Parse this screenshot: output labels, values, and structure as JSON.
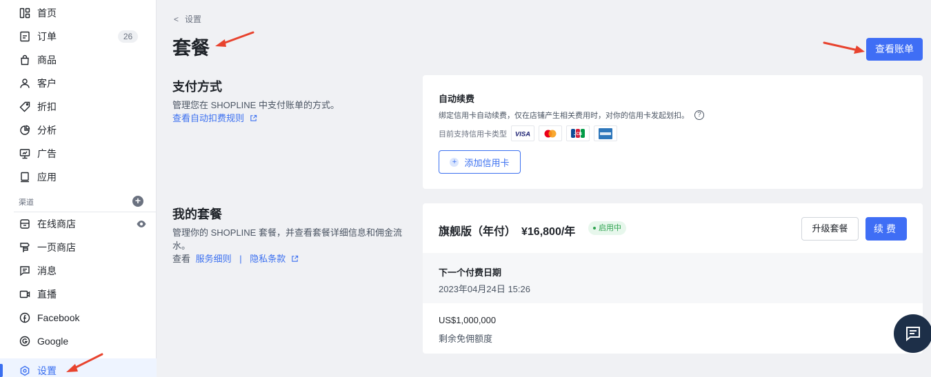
{
  "sidebar": {
    "items": [
      {
        "label": "首页",
        "icon": "dashboard-icon"
      },
      {
        "label": "订单",
        "icon": "order-icon",
        "badge": "26"
      },
      {
        "label": "商品",
        "icon": "bag-icon"
      },
      {
        "label": "客户",
        "icon": "user-icon"
      },
      {
        "label": "折扣",
        "icon": "tag-icon"
      },
      {
        "label": "分析",
        "icon": "pie-chart-icon"
      },
      {
        "label": "广告",
        "icon": "ad-monitor-icon"
      },
      {
        "label": "应用",
        "icon": "app-icon"
      }
    ],
    "channels_label": "渠道",
    "channels": [
      {
        "label": "在线商店",
        "icon": "store-icon"
      },
      {
        "label": "一页商店",
        "icon": "signpost-icon"
      },
      {
        "label": "消息",
        "icon": "message-icon"
      },
      {
        "label": "直播",
        "icon": "video-icon"
      },
      {
        "label": "Facebook",
        "icon": "facebook-icon"
      },
      {
        "label": "Google",
        "icon": "google-icon"
      }
    ],
    "settings_label": "设置"
  },
  "header": {
    "breadcrumb": "设置",
    "title": "套餐",
    "view_bill_label": "查看账单"
  },
  "payment": {
    "title": "支付方式",
    "description": "管理您在 SHOPLINE 中支付账单的方式。",
    "rules_link": "查看自动扣费规则",
    "auto_renew_title": "自动续费",
    "auto_renew_desc": "绑定信用卡自动续费，仅在店铺产生相关费用时，对你的信用卡发起划扣。",
    "supported_cards_label": "目前支持信用卡类型",
    "add_card_label": "添加信用卡"
  },
  "plan": {
    "title": "我的套餐",
    "description": "管理你的 SHOPLINE 套餐，并查看套餐详细信息和佣金流水。",
    "view_prefix": "查看",
    "service_terms_link": "服务细则",
    "separator": "|",
    "privacy_link": "隐私条款",
    "plan_name": "旗舰版（年付）",
    "plan_price": "¥16,800/年",
    "status": "启用中",
    "upgrade_label": "升级套餐",
    "renew_label": "续费",
    "next_payment_label": "下一个付费日期",
    "next_payment_value": "2023年04月24日 15:26",
    "commission_amount": "US$1,000,000",
    "commission_label": "剩余免佣额度"
  },
  "colors": {
    "primary": "#3f6ef5",
    "annotation_arrow": "#e8432e",
    "status_green": "#2ea34f",
    "chat_fab": "#1d2f48"
  }
}
